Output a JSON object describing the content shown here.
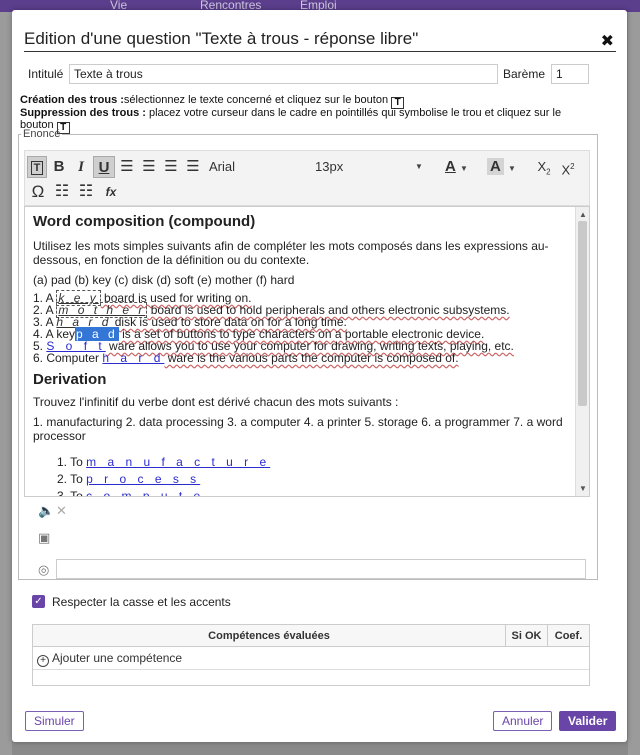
{
  "background": {
    "nav": [
      "Vie",
      "Rencontres",
      "Emploi"
    ]
  },
  "modal": {
    "title": "Edition d'une question \"Texte à trous - réponse libre\"",
    "intitule_label": "Intitulé",
    "intitule_value": "Texte à trous",
    "bareme_label": "Barème",
    "bareme_value": "1",
    "creation_label": "Création des trous :",
    "creation_text": "sélectionnez le texte concerné et cliquez sur le bouton",
    "suppression_label": "Suppression des trous :",
    "suppression_text": " placez votre curseur dans le cadre en pointillés qui symbolise le trou et cliquez sur le bouton",
    "tbutton_glyph": "T",
    "enonce_legend": "Enoncé"
  },
  "toolbar": {
    "font_name": "Arial",
    "font_size": "13px",
    "icons": [
      "hole-icon",
      "bold-icon",
      "italic-icon",
      "underline-icon",
      "align-left-icon",
      "align-center-icon",
      "align-right-icon",
      "justify-icon",
      "font-color-icon",
      "highlight-icon",
      "subscript-icon",
      "superscript-icon",
      "omega-icon",
      "bullet-list-icon",
      "numbered-list-icon",
      "formula-icon"
    ]
  },
  "editor": {
    "heading1": "Word composition (compound)",
    "intro": "Utilisez les mots simples suivants afin de compléter les mots composés dans les expressions au-dessous, en fonction de la définition ou du contexte.",
    "words": "(a) pad (b) key (c) disk (d) soft (e) mother (f) hard",
    "l1a": "1. A ",
    "l1gap": "k e y",
    "l1b": " board is used for writing on.",
    "l2a": "2. A ",
    "l2gap": "m o t h e r",
    "l2b": " board is used to hold peripherals and others electronic subsystems.",
    "l3a": "3. A ",
    "l3gap": "h a r d",
    "l3b": " disk is used to store data on for a long time.",
    "l4a": "4. A key",
    "l4gap": "p a d",
    "l4b": " is a set of buttons to type characters on a portable electronic device.",
    "l5gap": "S o f t",
    "l5b": " ware allows you to use your computer for drawing, writing texts, playing, etc.",
    "l5num": "5. ",
    "l6a": "6. Computer ",
    "l6gap": "h a r d",
    "l6b": " ware is the various parts the computer is composed of.",
    "heading2": "Derivation",
    "intro2": "Trouvez l'infinitif du verbe dont est dérivé chacun des mots suivants :",
    "list2": "1. manufacturing 2. data processing 3. a computer 4. a printer 5. storage 6. a programmer 7. a word processor",
    "ans1_num": "1. To ",
    "ans1_gap": "m a n u f a c t u r e",
    "ans2_num": "2. To ",
    "ans2_gap": "p r o c e s s",
    "ans3_num": "3. To ",
    "ans3_gap": "c o m p u t e"
  },
  "options": {
    "respect_label": "Respecter la casse et les accents"
  },
  "competences": {
    "col1": "Compétences évaluées",
    "col2": "Si OK",
    "col3": "Coef.",
    "add_label": "Ajouter une compétence"
  },
  "footer": {
    "simuler": "Simuler",
    "annuler": "Annuler",
    "valider": "Valider"
  },
  "colors": {
    "accent": "#6a45a8",
    "selection": "#3376d6",
    "gap_link": "#2b2bd0"
  }
}
